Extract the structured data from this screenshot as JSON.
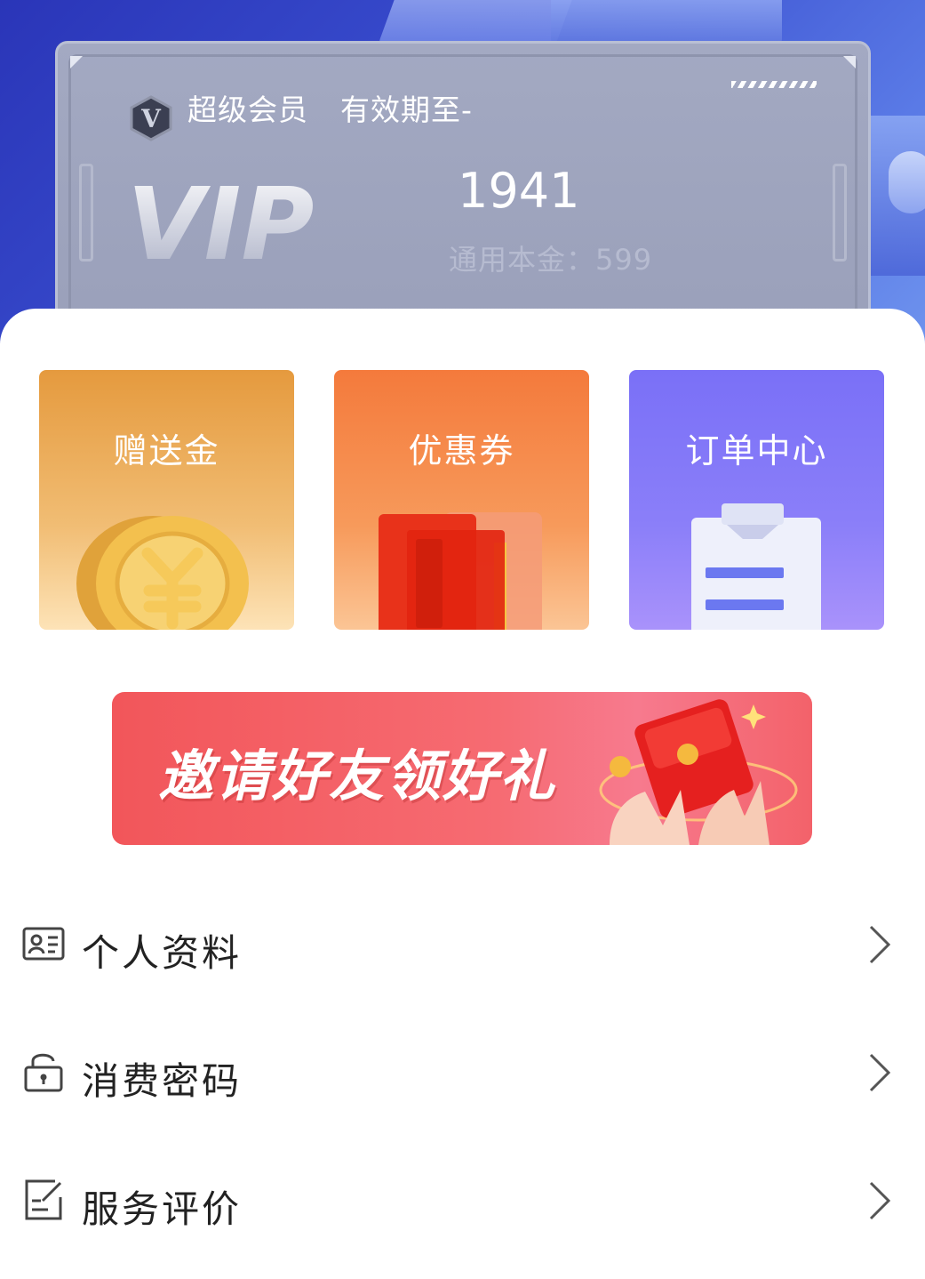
{
  "vip_card": {
    "level": "超级会员",
    "expiry": "有效期至-",
    "logo_text": "VIP",
    "badge_letter": "V",
    "balance": "1941",
    "principal": "通用本金：599"
  },
  "tiles": [
    {
      "label": "赠送金",
      "icon": "gold-coin-icon"
    },
    {
      "label": "优惠券",
      "icon": "coupon-cards-icon"
    },
    {
      "label": "订单中心",
      "icon": "clipboard-icon"
    }
  ],
  "banner": {
    "text": "邀请好友领好礼",
    "icon": "red-envelope-icon"
  },
  "menu": [
    {
      "label": "个人资料",
      "icon": "id-card-icon"
    },
    {
      "label": "消费密码",
      "icon": "unlock-icon"
    },
    {
      "label": "服务评价",
      "icon": "edit-note-icon"
    }
  ],
  "colors": {
    "header_blue": "#3a4fd0",
    "card_gray": "#a3a9c2",
    "gift_orange": "#e59a3e",
    "coupon_orange": "#f47a3c",
    "order_purple": "#7a70f7",
    "banner_red": "#f2565a"
  }
}
